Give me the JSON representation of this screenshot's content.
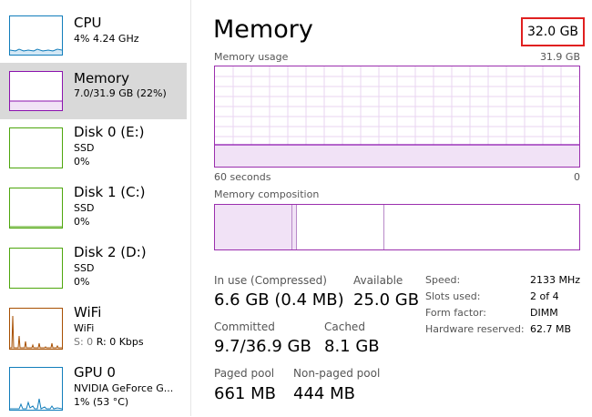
{
  "sidebar": {
    "items": [
      {
        "name": "CPU",
        "line1": "4%  4.24 GHz",
        "line2": ""
      },
      {
        "name": "Memory",
        "line1": "7.0/31.9 GB (22%)",
        "line2": ""
      },
      {
        "name": "Disk 0 (E:)",
        "line1": "SSD",
        "line2": "0%"
      },
      {
        "name": "Disk 1 (C:)",
        "line1": "SSD",
        "line2": "0%"
      },
      {
        "name": "Disk 2 (D:)",
        "line1": "SSD",
        "line2": "0%"
      },
      {
        "name": "WiFi",
        "line1": "WiFi",
        "line2_send": "S: 0",
        "line2_recv": "R: 0 Kbps"
      },
      {
        "name": "GPU 0",
        "line1": "NVIDIA GeForce G...",
        "line2": "1%  (53 °C)"
      }
    ],
    "colors": {
      "cpu": "#117dbb",
      "memory": "#8b12ae",
      "disk": "#4da60c",
      "wifi": "#a74f01",
      "gpu": "#117dbb"
    }
  },
  "main": {
    "title": "Memory",
    "total": "32.0 GB",
    "usage_label": "Memory usage",
    "usage_max": "31.9 GB",
    "time_label": "60 seconds",
    "time_min": "0",
    "composition_label": "Memory composition",
    "usage_fraction": 0.22,
    "stats": {
      "in_use_label": "In use (Compressed)",
      "in_use_value": "6.6 GB (0.4 MB)",
      "available_label": "Available",
      "available_value": "25.0 GB",
      "committed_label": "Committed",
      "committed_value": "9.7/36.9 GB",
      "cached_label": "Cached",
      "cached_value": "8.1 GB",
      "paged_label": "Paged pool",
      "paged_value": "661 MB",
      "nonpaged_label": "Non-paged pool",
      "nonpaged_value": "444 MB"
    },
    "details": [
      {
        "label": "Speed:",
        "value": "2133 MHz"
      },
      {
        "label": "Slots used:",
        "value": "2 of 4"
      },
      {
        "label": "Form factor:",
        "value": "DIMM"
      },
      {
        "label": "Hardware reserved:",
        "value": "62.7 MB"
      }
    ]
  }
}
